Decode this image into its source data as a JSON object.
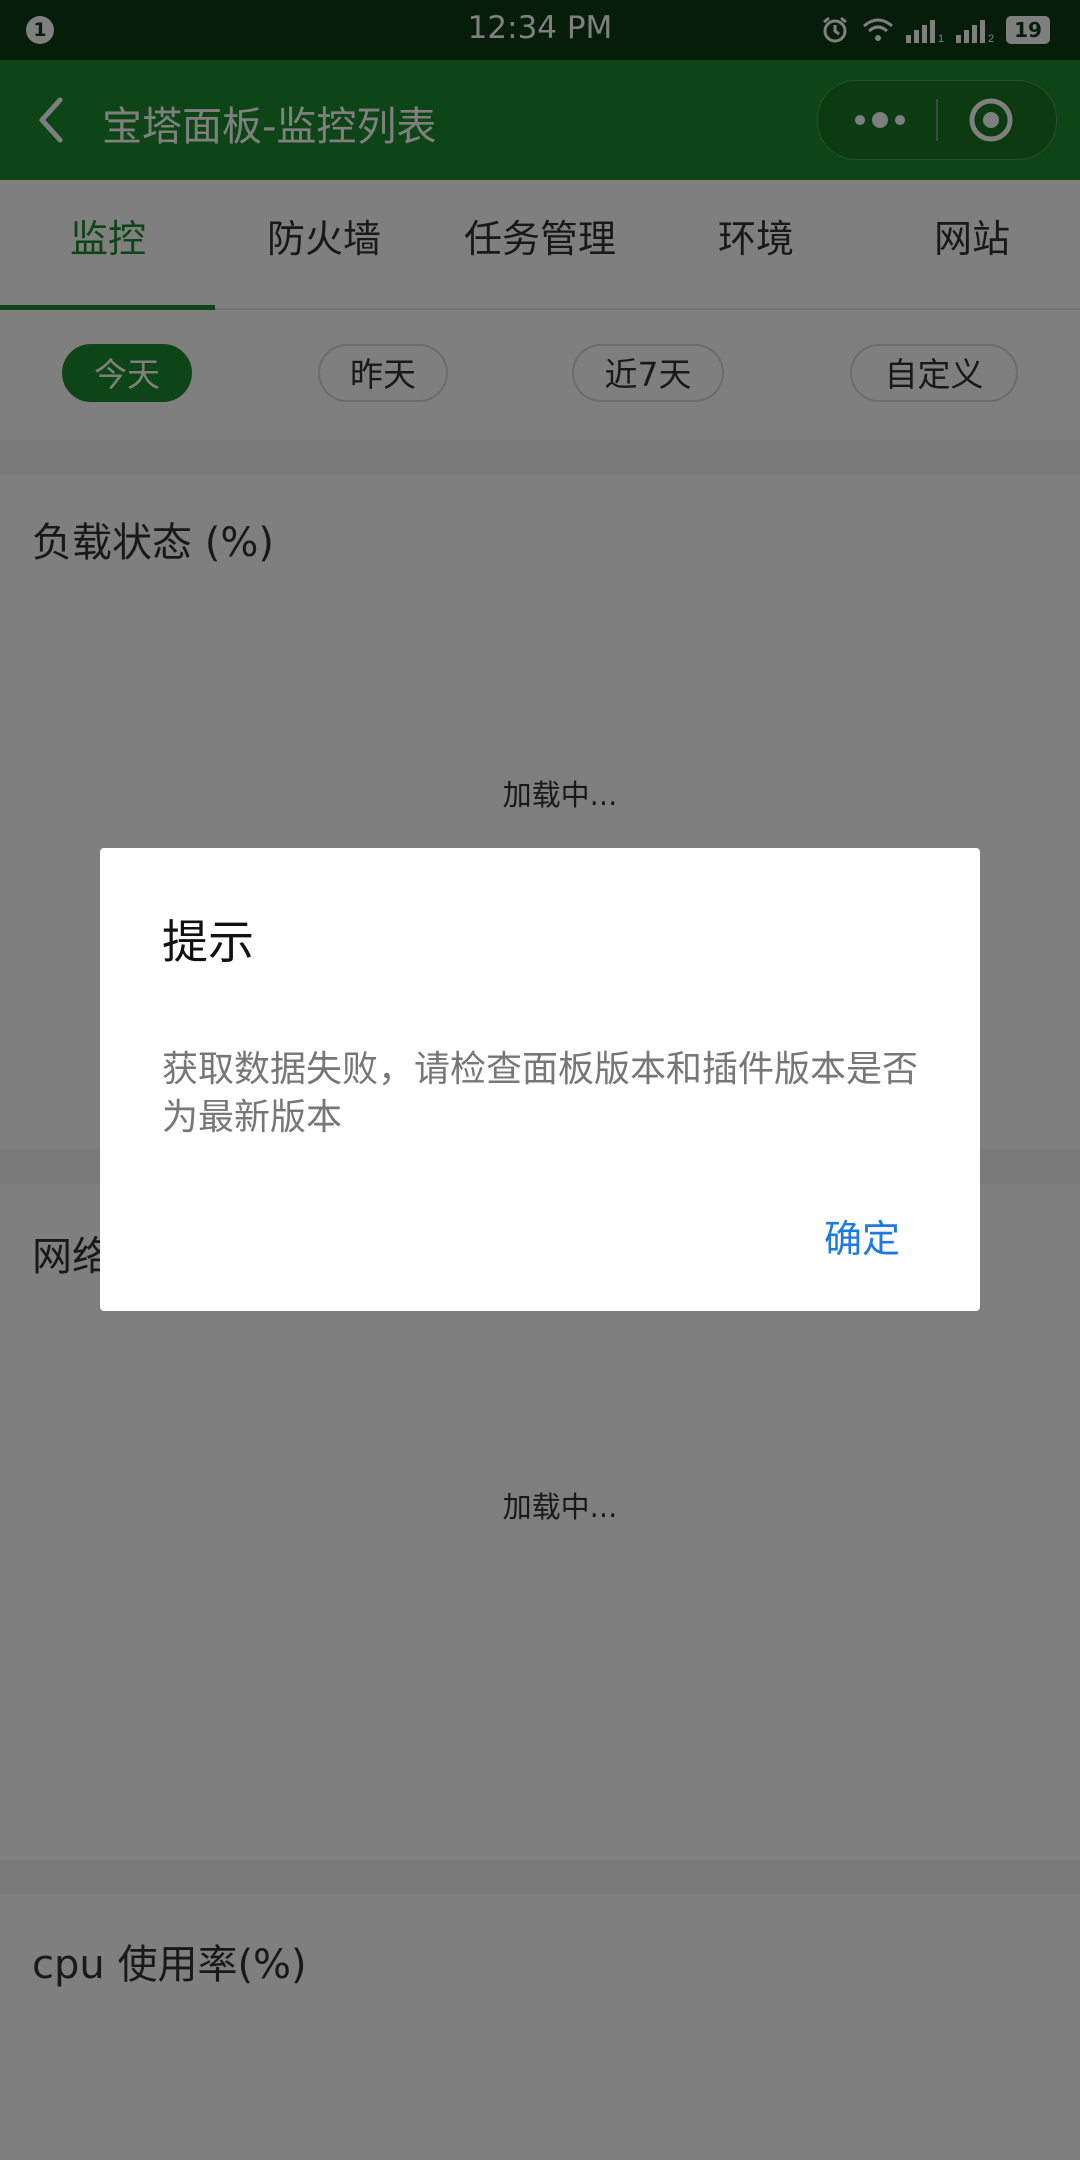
{
  "status_bar": {
    "notification_count": "1",
    "time": "12:34 PM",
    "battery": "19",
    "icons": [
      "alarm-icon",
      "wifi-icon",
      "signal-1-icon",
      "signal-2-icon",
      "battery-icon"
    ]
  },
  "nav": {
    "title": "宝塔面板-监控列表",
    "back_icon": "chevron-left-icon",
    "more_icon": "more-dots-icon",
    "close_icon": "target-circle-icon"
  },
  "tabs": [
    {
      "label": "监控",
      "active": true
    },
    {
      "label": "防火墙",
      "active": false
    },
    {
      "label": "任务管理",
      "active": false
    },
    {
      "label": "环境",
      "active": false
    },
    {
      "label": "网站",
      "active": false
    }
  ],
  "filters": [
    {
      "label": "今天",
      "active": true
    },
    {
      "label": "昨天",
      "active": false
    },
    {
      "label": "近7天",
      "active": false
    },
    {
      "label": "自定义",
      "active": false
    }
  ],
  "cards": [
    {
      "title": "负载状态 (%)",
      "loading": "加载中..."
    },
    {
      "title": "网络",
      "loading": "加载中..."
    },
    {
      "title": "cpu 使用率(%)"
    }
  ],
  "dialog": {
    "title": "提示",
    "content": "获取数据失败，请检查面板版本和插件版本是否为最新版本",
    "confirm_label": "确定"
  },
  "colors": {
    "primary_green": "#1c8a2c",
    "status_bar": "#0b3a12",
    "confirm_blue": "#1f7ae0"
  }
}
